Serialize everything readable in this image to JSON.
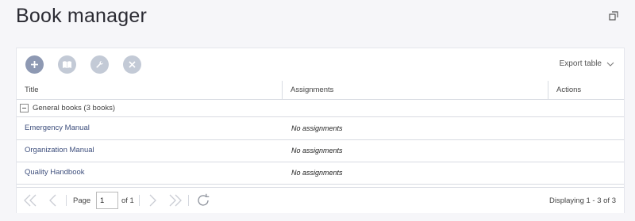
{
  "page": {
    "title": "Book manager"
  },
  "toolbar": {
    "add_icon": "plus-icon",
    "books_icon": "books-icon",
    "wrench_icon": "wrench-icon",
    "delete_icon": "close-icon",
    "export_label": "Export table"
  },
  "columns": {
    "title": "Title",
    "assignments": "Assignments",
    "actions": "Actions"
  },
  "group": {
    "label": "General books (3 books)"
  },
  "rows": [
    {
      "title": "Emergency Manual",
      "assignments": "No assignments"
    },
    {
      "title": "Organization Manual",
      "assignments": "No assignments"
    },
    {
      "title": "Quality Handbook",
      "assignments": "No assignments"
    }
  ],
  "pager": {
    "page_label": "Page",
    "page_value": "1",
    "of_label": "of 1",
    "displaying": "Displaying 1 - 3 of 3"
  },
  "colors": {
    "accent": "#8e99b3",
    "link": "#3e4f7d",
    "disabled": "#c3cad6"
  }
}
